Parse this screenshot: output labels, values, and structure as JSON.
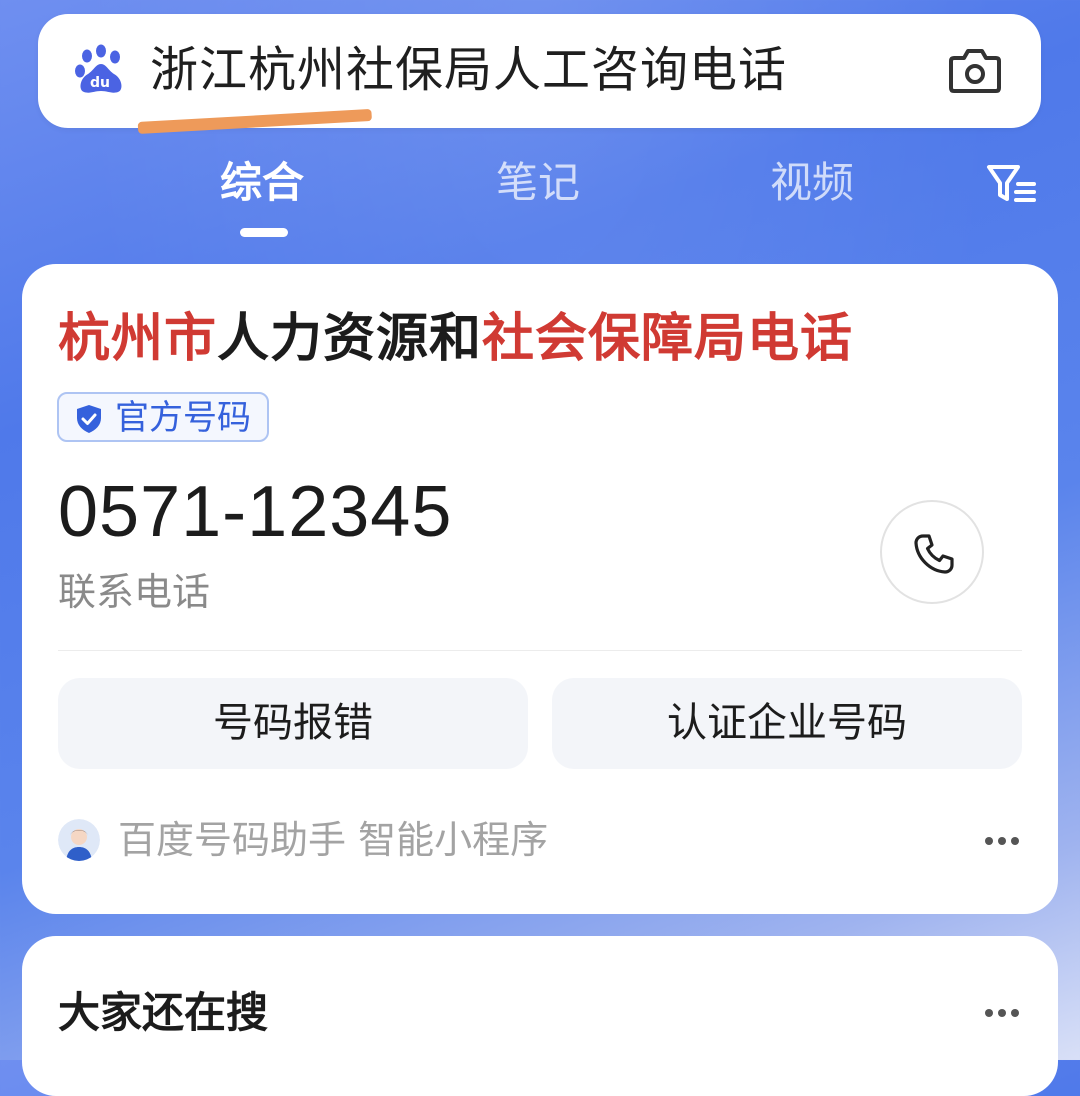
{
  "search": {
    "query": "浙江杭州社保局人工咨询电话",
    "logo_icon": "baidu-paw-icon",
    "camera_icon": "camera-icon"
  },
  "tabs": [
    {
      "label": "综合",
      "active": true
    },
    {
      "label": "笔记",
      "active": false
    },
    {
      "label": "视频",
      "active": false
    }
  ],
  "filter_icon": "filter-icon",
  "result": {
    "title_parts": [
      {
        "text": "杭州市",
        "highlight": true
      },
      {
        "text": "人力资源和",
        "highlight": false
      },
      {
        "text": "社会保障局电话",
        "highlight": true
      }
    ],
    "badge": "官方号码",
    "phone": "0571-12345",
    "phone_label": "联系电话",
    "call_icon": "phone-icon",
    "actions": {
      "report": "号码报错",
      "verify": "认证企业号码"
    },
    "source": "百度号码助手 智能小程序"
  },
  "related": {
    "title": "大家还在搜"
  },
  "colors": {
    "highlight": "#d03a33",
    "badge": "#3561dc",
    "underline": "#ee9a5a"
  }
}
